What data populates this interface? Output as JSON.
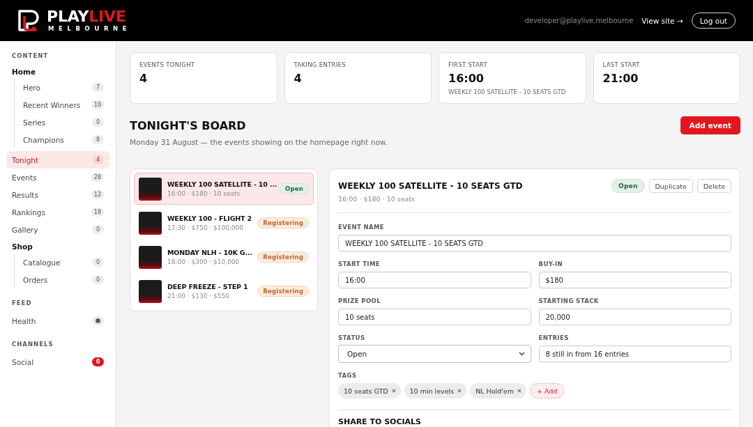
{
  "header": {
    "logo": {
      "name_start": "PLAY",
      "name_end": "LIVE",
      "tagline": "MELBOURNE"
    },
    "user_email": "developer@playlive.melbourne",
    "view_site": "View site →",
    "logout": "Log out"
  },
  "sidebar": {
    "sections": [
      {
        "heading": "CONTENT",
        "items": [
          {
            "kind": "group",
            "label": "Home",
            "children": [
              {
                "kind": "link",
                "label": "Hero",
                "selected": false,
                "badge": {
                  "kind": "count",
                  "text": "7"
                }
              },
              {
                "kind": "link",
                "label": "Recent Winners",
                "selected": false,
                "badge": {
                  "kind": "count",
                  "text": "10"
                }
              },
              {
                "kind": "link",
                "label": "Series",
                "selected": false,
                "badge": {
                  "kind": "count",
                  "text": "0"
                }
              },
              {
                "kind": "link",
                "label": "Champions",
                "selected": false,
                "badge": {
                  "kind": "count",
                  "text": "8"
                }
              }
            ]
          },
          {
            "kind": "link",
            "label": "Tonight",
            "selected": true,
            "badge": {
              "kind": "count",
              "text": "4"
            }
          },
          {
            "kind": "link",
            "label": "Events",
            "selected": false,
            "badge": {
              "kind": "count",
              "text": "28"
            }
          },
          {
            "kind": "link",
            "label": "Results",
            "selected": false,
            "badge": {
              "kind": "count",
              "text": "12"
            }
          },
          {
            "kind": "link",
            "label": "Rankings",
            "selected": false,
            "badge": {
              "kind": "count",
              "text": "18"
            }
          },
          {
            "kind": "link",
            "label": "Gallery",
            "selected": false,
            "badge": {
              "kind": "count",
              "text": "0"
            }
          },
          {
            "kind": "group",
            "label": "Shop",
            "children": [
              {
                "kind": "link",
                "label": "Catalogue",
                "selected": false,
                "badge": {
                  "kind": "count",
                  "text": "0"
                }
              },
              {
                "kind": "link",
                "label": "Orders",
                "selected": false,
                "badge": {
                  "kind": "count",
                  "text": "0"
                }
              }
            ]
          }
        ]
      },
      {
        "heading": "FEED",
        "items": [
          {
            "kind": "link",
            "label": "Health",
            "selected": false,
            "badge": {
              "kind": "dot"
            }
          }
        ]
      },
      {
        "heading": "CHANNELS",
        "items": [
          {
            "kind": "link",
            "label": "Social",
            "selected": false,
            "badge": {
              "kind": "alert",
              "text": "0"
            }
          }
        ]
      }
    ]
  },
  "stats": [
    {
      "label": "EVENTS TONIGHT",
      "value": "4"
    },
    {
      "label": "TAKING ENTRIES",
      "value": "4"
    },
    {
      "label": "FIRST START",
      "value": "16:00",
      "note": "WEEKLY 100 SATELLITE - 10 SEATS GTD"
    },
    {
      "label": "LAST START",
      "value": "21:00"
    }
  ],
  "board": {
    "title": "TONIGHT'S BOARD",
    "subtitle": "Monday 31 August — the events showing on the homepage right now.",
    "add_button": "Add event"
  },
  "events": [
    {
      "title": "WEEKLY 100 SATELLITE - 10 ...",
      "meta": "16:00 · $180 · 10 seats",
      "status": {
        "kind": "open",
        "text": "Open"
      },
      "selected": true
    },
    {
      "title": "WEEKLY 100 - FLIGHT 2",
      "meta": "17:30 · $750 · $100,000",
      "status": {
        "kind": "registering",
        "text": "Registering"
      },
      "selected": false
    },
    {
      "title": "MONDAY NLH - 10K G...",
      "meta": "18:00 · $300 · $10,000",
      "status": {
        "kind": "registering",
        "text": "Registering"
      },
      "selected": false
    },
    {
      "title": "DEEP FREEZE - STEP 1",
      "meta": "21:00 · $130 · $550",
      "status": {
        "kind": "registering",
        "text": "Registering"
      },
      "selected": false
    }
  ],
  "detail": {
    "title": "WEEKLY 100 SATELLITE - 10 SEATS GTD",
    "status": {
      "kind": "open",
      "text": "Open"
    },
    "actions": [
      "Duplicate",
      "Delete"
    ],
    "meta": "16:00 · $180 · 10 seats",
    "name_field": {
      "label": "EVENT NAME",
      "value": "WEEKLY 100 SATELLITE - 10 SEATS GTD"
    },
    "field_rows": [
      [
        {
          "kind": "text",
          "label": "START TIME",
          "value": "16:00"
        },
        {
          "kind": "text",
          "label": "BUY-IN",
          "value": "$180"
        }
      ],
      [
        {
          "kind": "text",
          "label": "PRIZE POOL",
          "value": "10 seats"
        },
        {
          "kind": "text",
          "label": "STARTING STACK",
          "value": "20,000"
        }
      ],
      [
        {
          "kind": "select",
          "label": "STATUS",
          "value": "Open"
        },
        {
          "kind": "text",
          "label": "ENTRIES",
          "value": "8 still in from 16 entries"
        }
      ]
    ],
    "tags": {
      "label": "TAGS",
      "items": [
        "10 seats GTD",
        "10 min levels",
        "NL Hold'em"
      ],
      "add_label": "+ Add"
    },
    "next_section": "SHARE TO SOCIALS"
  }
}
